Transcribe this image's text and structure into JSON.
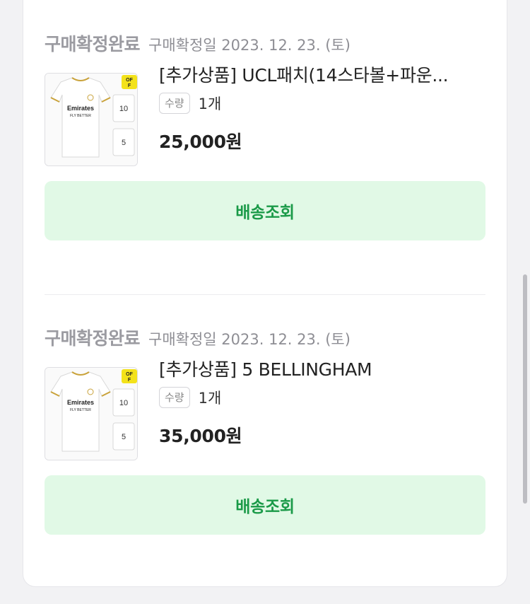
{
  "orders": [
    {
      "status": "구매확정완료",
      "confirm_date": "구매확정일 2023. 12. 23. (토)",
      "product_name": "[추가상품] UCL패치(14스타볼+파운...",
      "qty_label": "수량",
      "qty_value": "1개",
      "price": "25,000원",
      "track_button": "배송조회",
      "thumbnail": {
        "icon": "jersey-icon",
        "badge": "OFF"
      }
    },
    {
      "status": "구매확정완료",
      "confirm_date": "구매확정일 2023. 12. 23. (토)",
      "product_name": "[추가상품] 5 BELLINGHAM",
      "qty_label": "수량",
      "qty_value": "1개",
      "price": "35,000원",
      "track_button": "배송조회",
      "thumbnail": {
        "icon": "jersey-icon",
        "badge": "OFF"
      }
    }
  ],
  "colors": {
    "accent_green": "#1a9a48",
    "button_bg": "#e1f9e6",
    "badge_yellow": "#f3e21a"
  }
}
